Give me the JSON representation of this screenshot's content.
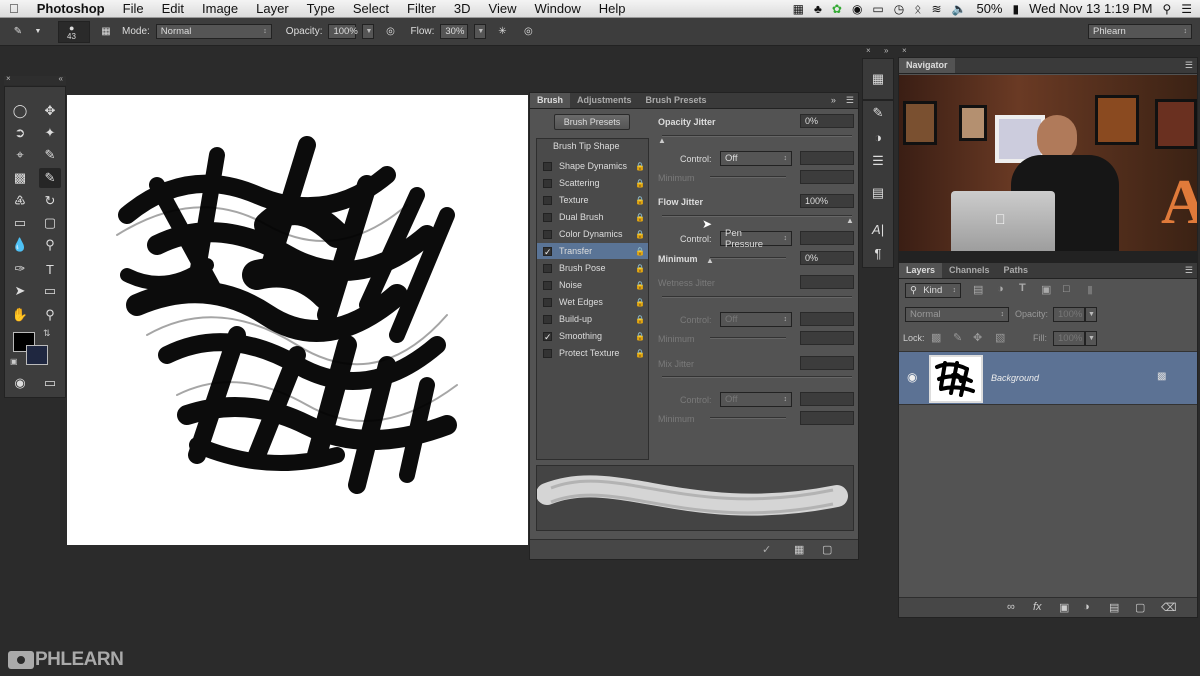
{
  "menubar": {
    "app_name": "Photoshop",
    "items": [
      "File",
      "Edit",
      "Image",
      "Layer",
      "Type",
      "Select",
      "Filter",
      "3D",
      "View",
      "Window",
      "Help"
    ],
    "battery": "50%",
    "datetime": "Wed Nov 13  1:19 PM",
    "apple_icon": "apple-icon",
    "status_icons": [
      "wifi-icon",
      "volume-icon",
      "bluetooth-icon",
      "clock-icon",
      "search-icon",
      "list-icon"
    ]
  },
  "options": {
    "brush_size": "43",
    "mode_label": "Mode:",
    "mode_value": "Normal",
    "opacity_label": "Opacity:",
    "opacity_value": "100%",
    "flow_label": "Flow:",
    "flow_value": "30%",
    "workspace": "Phlearn"
  },
  "brush_panel": {
    "tabs": [
      "Brush",
      "Adjustments",
      "Brush Presets"
    ],
    "presets_button": "Brush Presets",
    "tip_shape": "Brush Tip Shape",
    "items": [
      {
        "label": "Shape Dynamics",
        "checked": false
      },
      {
        "label": "Scattering",
        "checked": false
      },
      {
        "label": "Texture",
        "checked": false
      },
      {
        "label": "Dual Brush",
        "checked": false
      },
      {
        "label": "Color Dynamics",
        "checked": false
      },
      {
        "label": "Transfer",
        "checked": true,
        "selected": true
      },
      {
        "label": "Brush Pose",
        "checked": false
      },
      {
        "label": "Noise",
        "checked": false
      },
      {
        "label": "Wet Edges",
        "checked": false
      },
      {
        "label": "Build-up",
        "checked": false
      },
      {
        "label": "Smoothing",
        "checked": true
      },
      {
        "label": "Protect Texture",
        "checked": false
      }
    ],
    "opacity_jitter_label": "Opacity Jitter",
    "opacity_jitter_value": "0%",
    "control_label": "Control:",
    "control1_value": "Off",
    "minimum_label": "Minimum",
    "flow_jitter_label": "Flow Jitter",
    "flow_jitter_value": "100%",
    "control2_value": "Pen Pressure",
    "minimum2_value": "0%",
    "wetness_label": "Wetness Jitter",
    "control3_value": "Off",
    "mix_label": "Mix Jitter",
    "control4_value": "Off"
  },
  "navigator": {
    "title": "Navigator"
  },
  "layers": {
    "tabs": [
      "Layers",
      "Channels",
      "Paths"
    ],
    "kind_label": "Kind",
    "blend_mode": "Normal",
    "opacity_label": "Opacity:",
    "opacity_value": "100%",
    "lock_label": "Lock:",
    "fill_label": "Fill:",
    "fill_value": "100%",
    "layer_name": "Background"
  },
  "watermark": "PHLEARN",
  "colors": {
    "accent": "#5a7496",
    "panel": "#535353",
    "dark": "#2b2b2b"
  }
}
